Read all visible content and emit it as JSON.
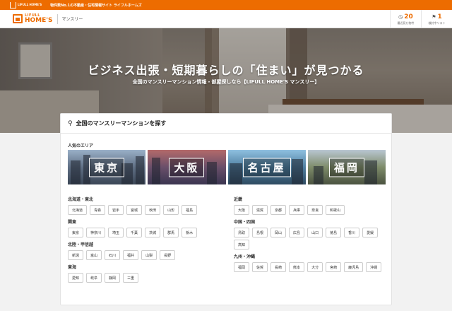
{
  "topbar": {
    "logo_text": "LIFULL HOME'S",
    "tagline": "物件数No.1の不動産・住宅情報サイト ライフルホームズ"
  },
  "header": {
    "logo_line1": "LIFULL",
    "logo_line2": "HOME'S",
    "service_name": "マンスリー",
    "recent": {
      "count": "20",
      "label": "最近見た物件"
    },
    "favorites": {
      "count": "1",
      "label": "検討中リスト"
    }
  },
  "hero": {
    "title": "ビジネス出張・短期暮らしの「住まい」が見つかる",
    "subtitle": "全国のマンスリーマンション情報・部屋探しなら【LIFULL HOME'S マンスリー】"
  },
  "search": {
    "heading": "全国のマンスリーマンションを探す",
    "popular_title": "人気のエリア",
    "popular_areas": [
      "東京",
      "大阪",
      "名古屋",
      "福岡"
    ],
    "regions_left": [
      {
        "name": "北海道・東北",
        "prefs": [
          "北海道",
          "青森",
          "岩手",
          "宮城",
          "秋田",
          "山形",
          "福島"
        ]
      },
      {
        "name": "関東",
        "prefs": [
          "東京",
          "神奈川",
          "埼玉",
          "千葉",
          "茨城",
          "群馬",
          "栃木"
        ]
      },
      {
        "name": "北陸・甲信越",
        "prefs": [
          "新潟",
          "富山",
          "石川",
          "福井",
          "山梨",
          "長野"
        ]
      },
      {
        "name": "東海",
        "prefs": [
          "愛知",
          "岐阜",
          "静岡",
          "三重"
        ]
      }
    ],
    "regions_right": [
      {
        "name": "近畿",
        "prefs": [
          "大阪",
          "滋賀",
          "京都",
          "兵庫",
          "奈良",
          "和歌山"
        ]
      },
      {
        "name": "中国・四国",
        "prefs": [
          "鳥取",
          "島根",
          "岡山",
          "広島",
          "山口",
          "徳島",
          "香川",
          "愛媛",
          "高知"
        ]
      },
      {
        "name": "九州・沖縄",
        "prefs": [
          "福岡",
          "佐賀",
          "長崎",
          "熊本",
          "大分",
          "宮崎",
          "鹿児島",
          "沖縄"
        ]
      }
    ]
  }
}
